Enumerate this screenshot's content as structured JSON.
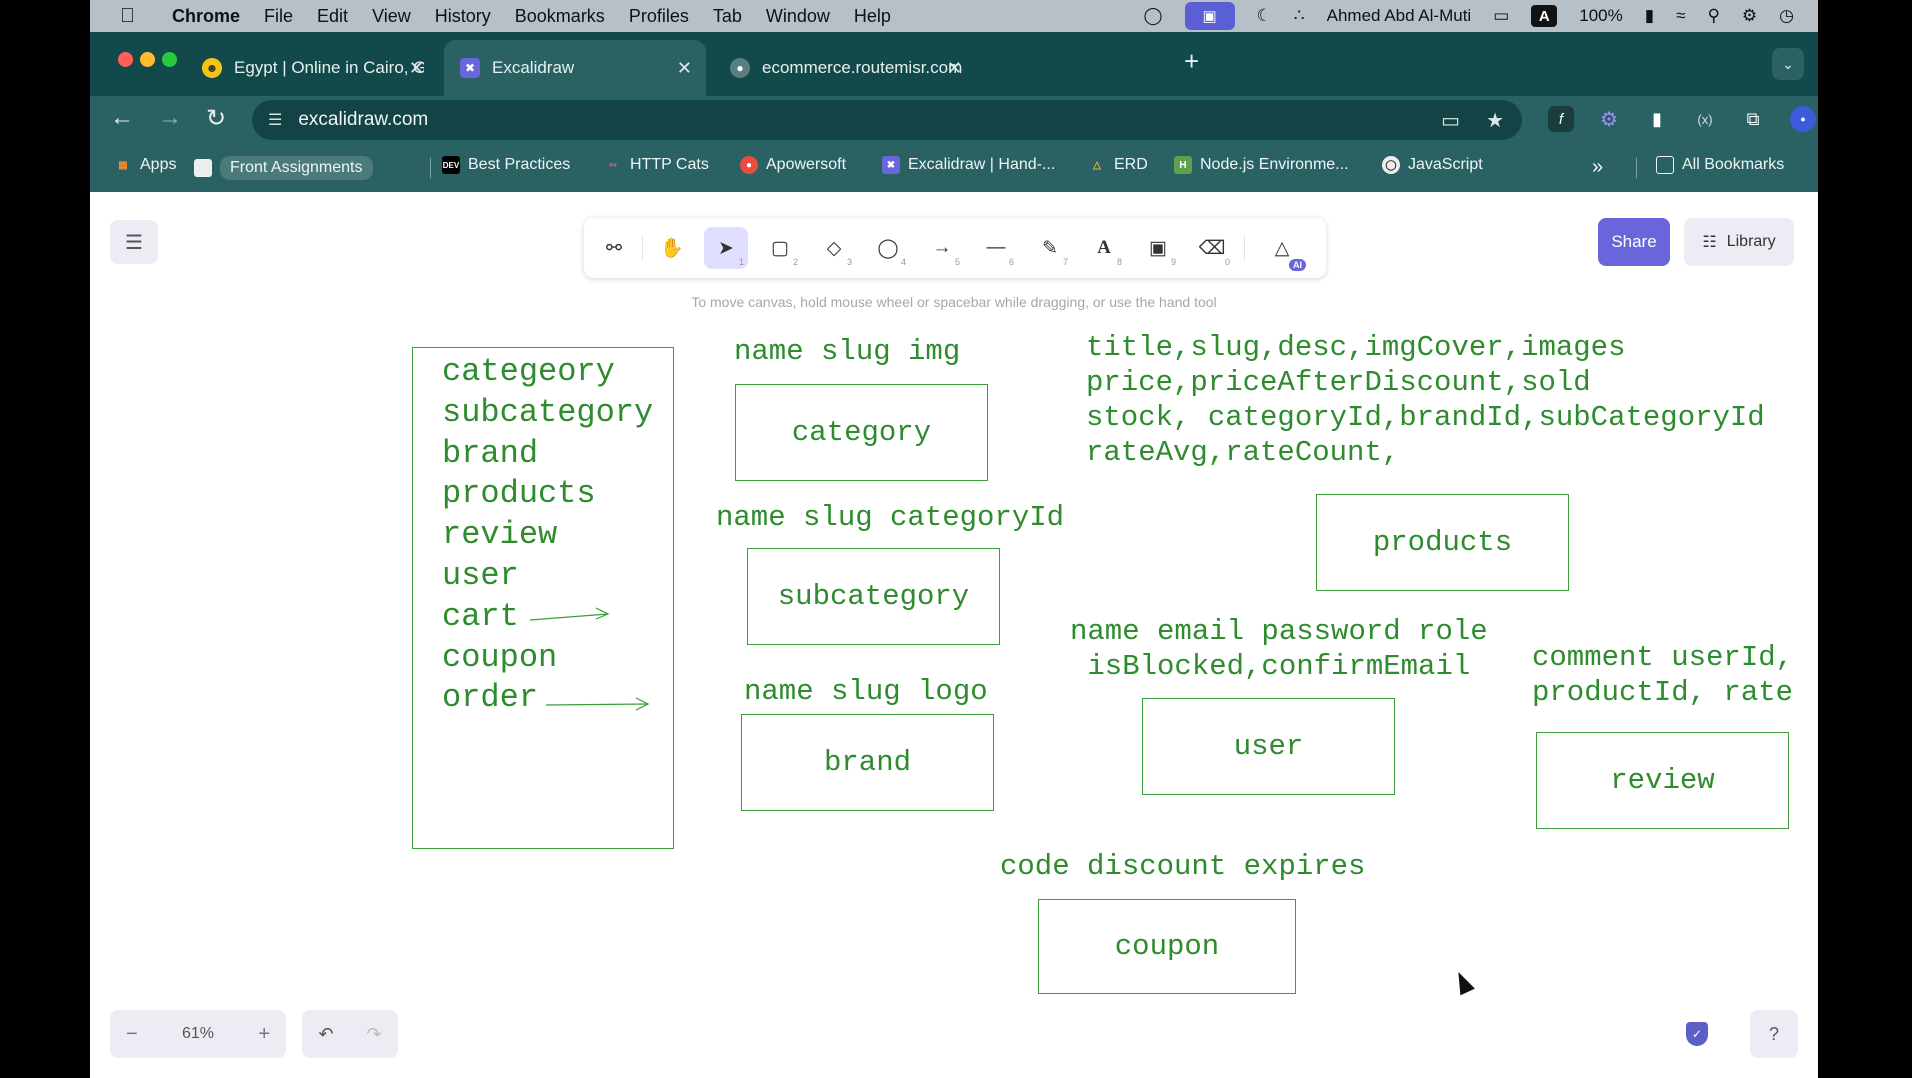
{
  "menubar": {
    "app": "Chrome",
    "items": [
      "File",
      "Edit",
      "View",
      "History",
      "Bookmarks",
      "Profiles",
      "Tab",
      "Window",
      "Help"
    ],
    "user": "Ahmed Abd Al-Muti",
    "input_source": "A",
    "battery": "100%"
  },
  "tabs": [
    {
      "title": "Egypt | Online in Cairo, Giza |",
      "icon": "smiley-icon",
      "active": false
    },
    {
      "title": "Excalidraw",
      "icon": "excalidraw-icon",
      "active": true
    },
    {
      "title": "ecommerce.routemisr.com/ap",
      "icon": "globe-icon",
      "active": false
    }
  ],
  "address": {
    "url": "excalidraw.com"
  },
  "bookmarks": {
    "items": [
      {
        "label": "Apps",
        "icon": "apps-grid-icon"
      },
      {
        "label": "Front Assignments",
        "icon": "folder-icon",
        "chip": true
      },
      {
        "label": "Best Practices",
        "icon": "dev-icon"
      },
      {
        "label": "HTTP Cats",
        "icon": "cat-icon"
      },
      {
        "label": "Apowersoft",
        "icon": "apowersoft-icon"
      },
      {
        "label": "Excalidraw | Hand-...",
        "icon": "excalidraw-icon"
      },
      {
        "label": "ERD",
        "icon": "erd-icon"
      },
      {
        "label": "Node.js Environme...",
        "icon": "nodejs-icon"
      },
      {
        "label": "JavaScript",
        "icon": "globe-icon"
      }
    ],
    "all_label": "All Bookmarks"
  },
  "excalidraw": {
    "share_label": "Share",
    "library_label": "Library",
    "hint": "To move canvas, hold mouse wheel or spacebar while dragging, or use the hand tool",
    "zoom": "61%",
    "tools": [
      {
        "name": "lock-icon",
        "key": ""
      },
      {
        "name": "hand-icon",
        "key": ""
      },
      {
        "name": "selection-icon",
        "key": "1"
      },
      {
        "name": "rectangle-icon",
        "key": "2"
      },
      {
        "name": "diamond-icon",
        "key": "3"
      },
      {
        "name": "ellipse-icon",
        "key": "4"
      },
      {
        "name": "arrow-icon",
        "key": "5"
      },
      {
        "name": "line-icon",
        "key": "6"
      },
      {
        "name": "pencil-icon",
        "key": "7"
      },
      {
        "name": "text-icon",
        "key": "8"
      },
      {
        "name": "image-icon",
        "key": "9"
      },
      {
        "name": "eraser-icon",
        "key": "0"
      },
      {
        "name": "shapes-ai-icon",
        "key": "AI"
      }
    ],
    "accent": "#6965db",
    "drawing_color": "#2e8b2e"
  },
  "diagram": {
    "list": [
      "categeory",
      "subcategory",
      "brand",
      "products",
      "review",
      "user",
      "cart",
      "coupon",
      "order"
    ],
    "fields": {
      "category": "name slug img",
      "subcategory": "name slug categoryId",
      "brand": "name slug logo",
      "products": [
        "title,slug,desc,imgCover,images",
        "price,priceAfterDiscount,sold",
        "stock, categoryId,brandId,subCategoryId",
        "rateAvg,rateCount,"
      ],
      "user": [
        "name email password role",
        " isBlocked,confirmEmail"
      ],
      "review": [
        "comment userId,",
        "productId, rate"
      ],
      "coupon": "code discount expires"
    },
    "entities": {
      "category": "category",
      "subcategory": "subcategory",
      "brand": "brand",
      "products": "products",
      "user": "user",
      "review": "review",
      "coupon": "coupon"
    }
  }
}
